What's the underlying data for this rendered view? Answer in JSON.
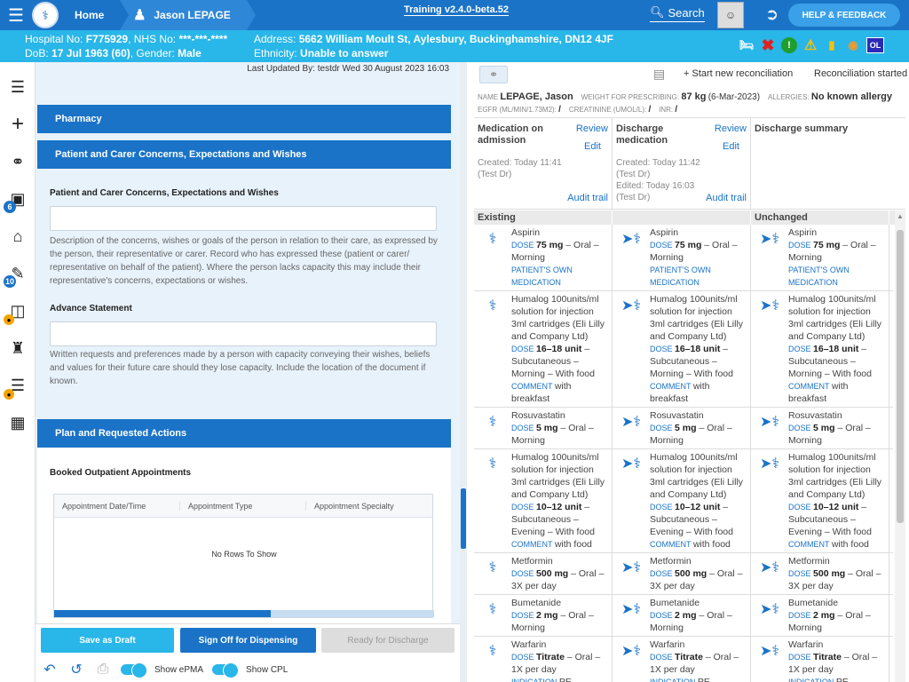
{
  "topbar": {
    "home_label": "Home",
    "patient_label": "Jason LEPAGE",
    "training_label": "Training v2.4.0-beta.52",
    "search_label": "Search",
    "help_label": "HELP & FEEDBACK"
  },
  "banner": {
    "hospital_prefix": "Hospital No: ",
    "hospital_no": "F775929",
    "nhs_prefix": ", NHS No: ",
    "nhs_no": "***-***-****",
    "dob_prefix": "DoB: ",
    "dob": "17 Jul 1963 (60)",
    "gender_prefix": ", Gender: ",
    "gender": "Male",
    "address_prefix": "Address: ",
    "address": "5662 William Moult St, Aylesbury, Buckinghamshire, DN12 4JF",
    "ethnicity_prefix": "Ethnicity: ",
    "ethnicity": "Unable to answer",
    "ol_label": "OL"
  },
  "sidebar": {
    "badge_camera": "6",
    "badge_edit": "10"
  },
  "left": {
    "last_updated": "Last Updated By: testdr Wed 30 August 2023 16:03",
    "pharmacy_header": "Pharmacy",
    "concerns_header": "Patient and Carer Concerns, Expectations and Wishes",
    "concerns_label": "Patient and Carer Concerns, Expectations and Wishes",
    "concerns_value": "",
    "concerns_desc": "Description of the concerns, wishes or goals of the person in relation to their care, as expressed by the person, their representative or carer. Record who has expressed these (patient or carer/ representative on behalf of the patient). Where the person lacks capacity this may include their representative's concerns, expectations or wishes.",
    "advance_label": "Advance Statement",
    "advance_value": "",
    "advance_desc": "Written requests and preferences made by a person with capacity conveying their wishes, beliefs and values for their future care should they lose capacity. Include the location of the document if known.",
    "plan_header": "Plan and Requested Actions",
    "booked_label": "Booked Outpatient Appointments",
    "grid_columns": [
      "Appointment Date/Time",
      "Appointment Type",
      "Appointment Specialty"
    ],
    "grid_empty": "No Rows To Show",
    "grid_scroll_fraction": 0.57
  },
  "actions": {
    "save_draft": "Save as Draft",
    "sign_off": "Sign Off for Dispensing",
    "ready": "Ready for Discharge",
    "show_epma": "Show ePMA",
    "show_cpl": "Show CPL"
  },
  "right": {
    "start_label": "Start new reconciliation",
    "started_label": "Reconciliation started",
    "name_label": "NAME",
    "name_value": "LEPAGE, Jason",
    "weight_label": "WEIGHT FOR PRESCRIBING:",
    "weight_value": "87 kg",
    "weight_date": "(6-Mar-2023)",
    "allergies_label": "ALLERGIES:",
    "allergies_value": "No known allergy",
    "egfr_label": "EGFR (ML/MIN/1.73M2):",
    "egfr_value": "/",
    "creat_label": "CREATININE (UMOL/L):",
    "creat_value": "/",
    "inr_label": "INR:",
    "inr_value": "/",
    "col1": {
      "title": "Medication on admission",
      "review": "Review",
      "edit": "Edit",
      "created": "Created: Today 11:41",
      "by": "(Test Dr)",
      "audit": "Audit trail"
    },
    "col2": {
      "title": "Discharge medication",
      "review": "Review",
      "edit": "Edit",
      "created": "Created: Today 11:42",
      "by": "(Test Dr)",
      "edited": "Edited: Today 16:03",
      "by2": "(Test Dr)",
      "audit": "Audit trail"
    },
    "col3": {
      "title": "Discharge summary"
    },
    "list_headers": [
      "Existing",
      "",
      "Unchanged"
    ],
    "dose_label": "DOSE",
    "comment_label": "COMMENT",
    "indication_label": "INDICATION",
    "own_med_label": "PATIENT'S OWN MEDICATION",
    "medications": [
      {
        "name": "Aspirin",
        "dose": "75 mg",
        "route": "– Oral –",
        "freq": "Morning",
        "own": true,
        "comment": ""
      },
      {
        "name": "Humalog 100units/ml solution for injection 3ml cartridges (Eli Lilly and Company Ltd)",
        "dose": "16–18 unit",
        "route": "– Subcutaneous –",
        "freq": "Morning – With food",
        "own": false,
        "comment": "with breakfast"
      },
      {
        "name": "Rosuvastatin",
        "dose": "5 mg",
        "route": "– Oral –",
        "freq": "Morning",
        "own": false,
        "comment": ""
      },
      {
        "name": "Humalog 100units/ml solution for injection 3ml cartridges (Eli Lilly and Company Ltd)",
        "dose": "10–12 unit",
        "route": "– Subcutaneous –",
        "freq": "Evening – With food",
        "own": false,
        "comment": "with food"
      },
      {
        "name": "Metformin",
        "dose": "500 mg",
        "route": "– Oral –",
        "freq": "3X per day",
        "own": false,
        "comment": ""
      },
      {
        "name": "Bumetanide",
        "dose": "2 mg",
        "route": "– Oral –",
        "freq": "Morning",
        "own": false,
        "comment": ""
      },
      {
        "name": "Warfarin",
        "dose": "Titrate",
        "route": "– Oral –",
        "freq": "1X per day",
        "own": false,
        "comment": "",
        "indication": "PE"
      }
    ]
  }
}
